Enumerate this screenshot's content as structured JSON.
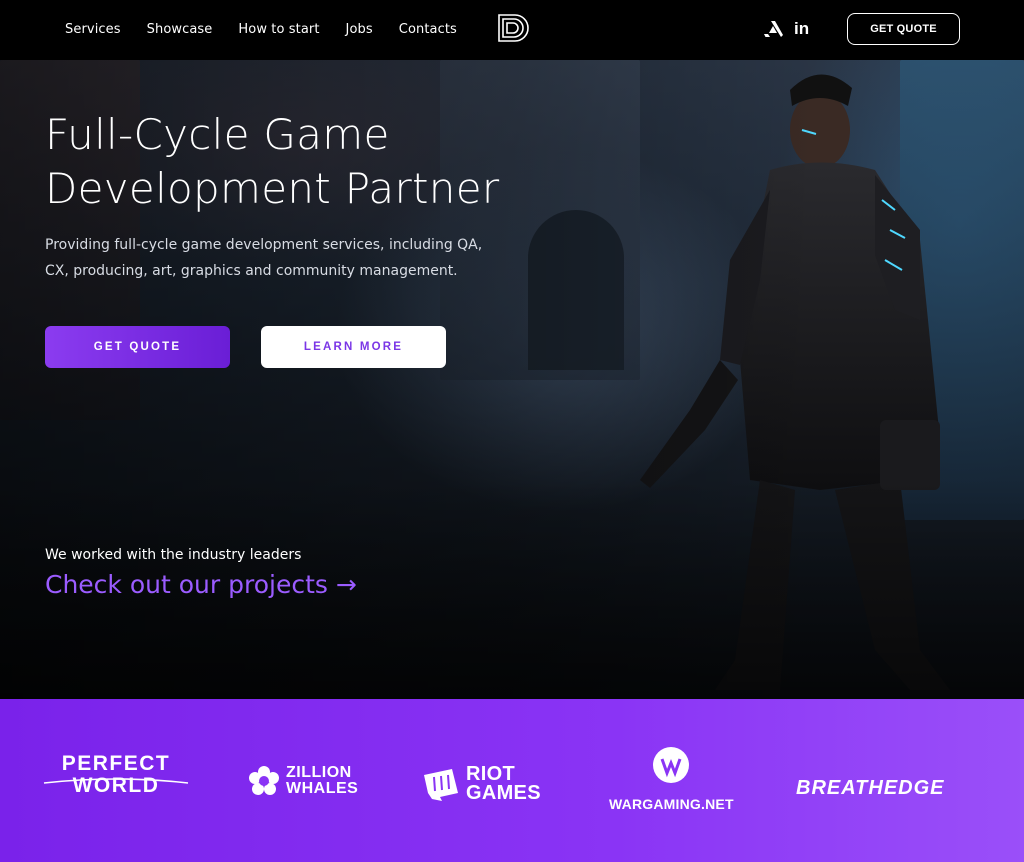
{
  "nav": {
    "links": [
      "Services",
      "Showcase",
      "How to start",
      "Jobs",
      "Contacts"
    ],
    "social": {
      "artstation_icon": "artstation-icon",
      "linkedin_icon": "linkedin-icon",
      "linkedin_glyph": "in"
    },
    "cta_label": "GET QUOTE"
  },
  "hero": {
    "title_line1": "Full-Cycle Game",
    "title_line2": "Development Partner",
    "subtitle": "Providing full-cycle game development services, including QA, CX, producing, art, graphics and community management.",
    "primary_button": "GET QUOTE",
    "secondary_button": "LEARN MORE",
    "worked_with": "We worked with the industry leaders",
    "projects_link": "Check out our projects →"
  },
  "partners": {
    "perfect_world_line1": "PERFECT",
    "perfect_world_line2": "WORLD",
    "zillion_line1": "ZILLION",
    "zillion_line2": "WHALES",
    "riot_line1": "RIOT",
    "riot_line2": "GAMES",
    "wargaming": "WARGAMING.NET",
    "breathedge": "BREATHEDGE"
  },
  "colors": {
    "accent": "#8b3cf0",
    "accent_text": "#9b5cff",
    "partners_bg": "#8a34f5",
    "nav_bg": "#000000"
  }
}
